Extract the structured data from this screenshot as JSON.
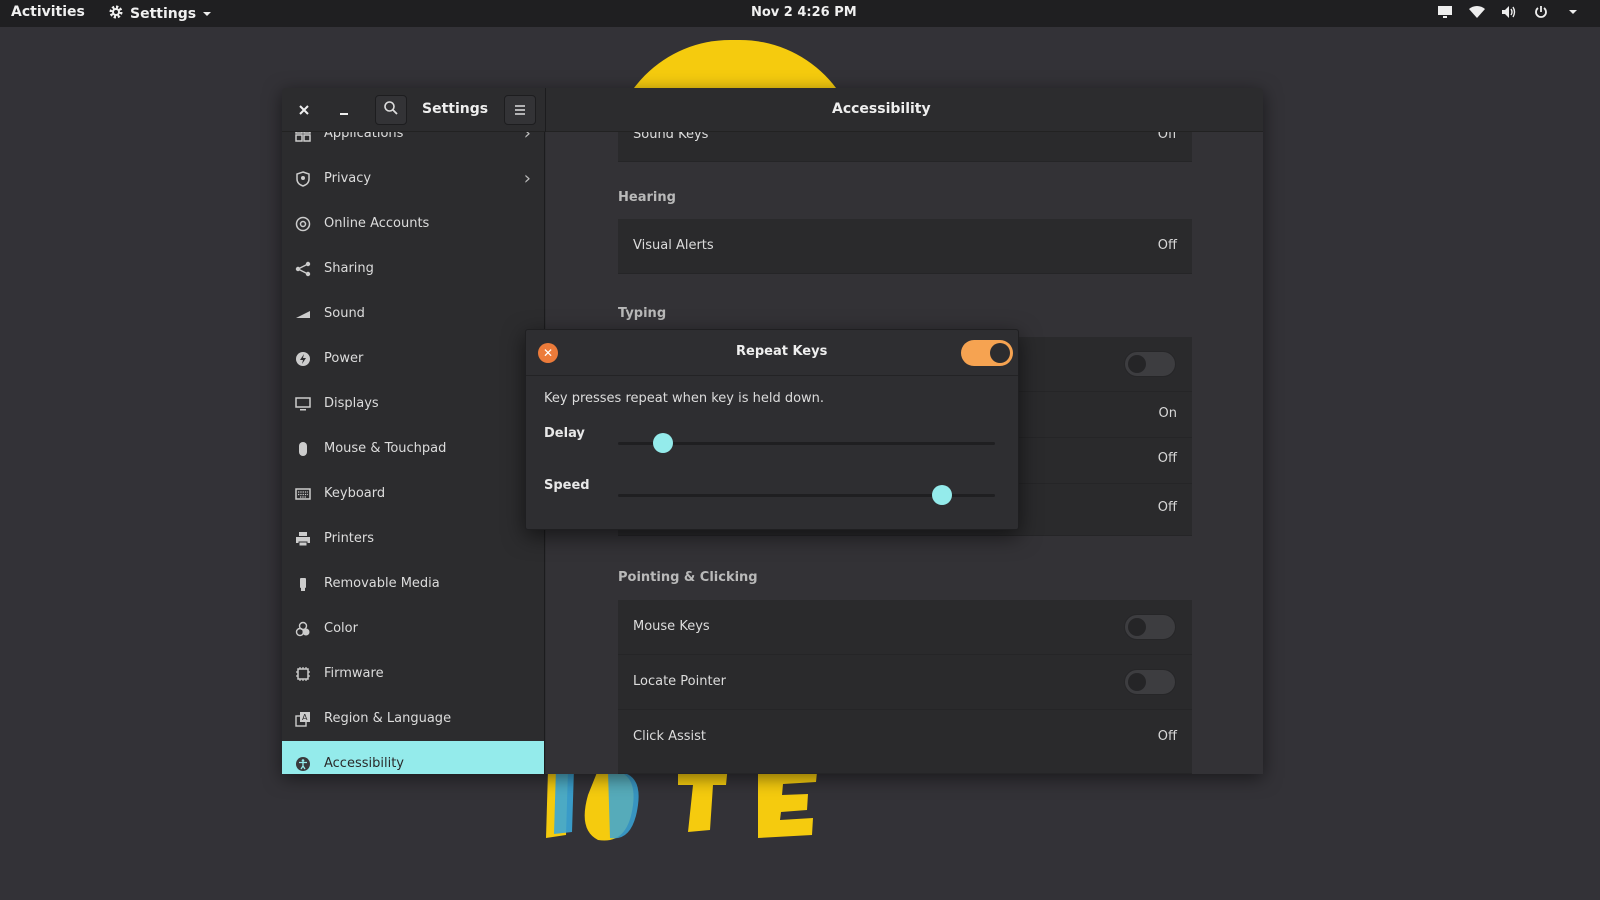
{
  "topbar": {
    "activities": "Activities",
    "app_menu": "Settings",
    "clock": "Nov 2   4:26 PM"
  },
  "window": {
    "sidebar_title": "Settings",
    "main_title": "Accessibility"
  },
  "sidebar": {
    "items": [
      {
        "label": "Applications",
        "icon": "applications-icon"
      },
      {
        "label": "Privacy",
        "icon": "privacy-icon"
      },
      {
        "label": "Online Accounts",
        "icon": "at-icon"
      },
      {
        "label": "Sharing",
        "icon": "share-icon"
      },
      {
        "label": "Sound",
        "icon": "sound-icon"
      },
      {
        "label": "Power",
        "icon": "power-icon"
      },
      {
        "label": "Displays",
        "icon": "display-icon"
      },
      {
        "label": "Mouse & Touchpad",
        "icon": "mouse-icon"
      },
      {
        "label": "Keyboard",
        "icon": "keyboard-icon"
      },
      {
        "label": "Printers",
        "icon": "printer-icon"
      },
      {
        "label": "Removable Media",
        "icon": "usb-icon"
      },
      {
        "label": "Color",
        "icon": "color-icon"
      },
      {
        "label": "Firmware",
        "icon": "chip-icon"
      },
      {
        "label": "Region & Language",
        "icon": "region-icon"
      },
      {
        "label": "Accessibility",
        "icon": "accessibility-icon"
      }
    ]
  },
  "main": {
    "top_row": {
      "label": "Sound Keys",
      "value": "Off"
    },
    "hearing": {
      "heading": "Hearing",
      "visual_alerts": {
        "label": "Visual Alerts",
        "value": "Off"
      }
    },
    "typing": {
      "heading": "Typing",
      "rows": [
        {
          "value": "On"
        },
        {
          "value": "Off"
        },
        {
          "value": "Off"
        }
      ]
    },
    "pointing": {
      "heading": "Pointing & Clicking",
      "mouse_keys": {
        "label": "Mouse Keys"
      },
      "locate_pointer": {
        "label": "Locate Pointer"
      },
      "click_assist": {
        "label": "Click Assist",
        "value": "Off"
      }
    }
  },
  "dialog": {
    "title": "Repeat Keys",
    "enabled": true,
    "description": "Key presses repeat when key is held down.",
    "delay_label": "Delay",
    "delay_value": 0.12,
    "speed_label": "Speed",
    "speed_value": 0.86
  },
  "colors": {
    "accent": "#94ebeb",
    "toggle_on": "#f6a351",
    "close": "#ec7b3a"
  }
}
